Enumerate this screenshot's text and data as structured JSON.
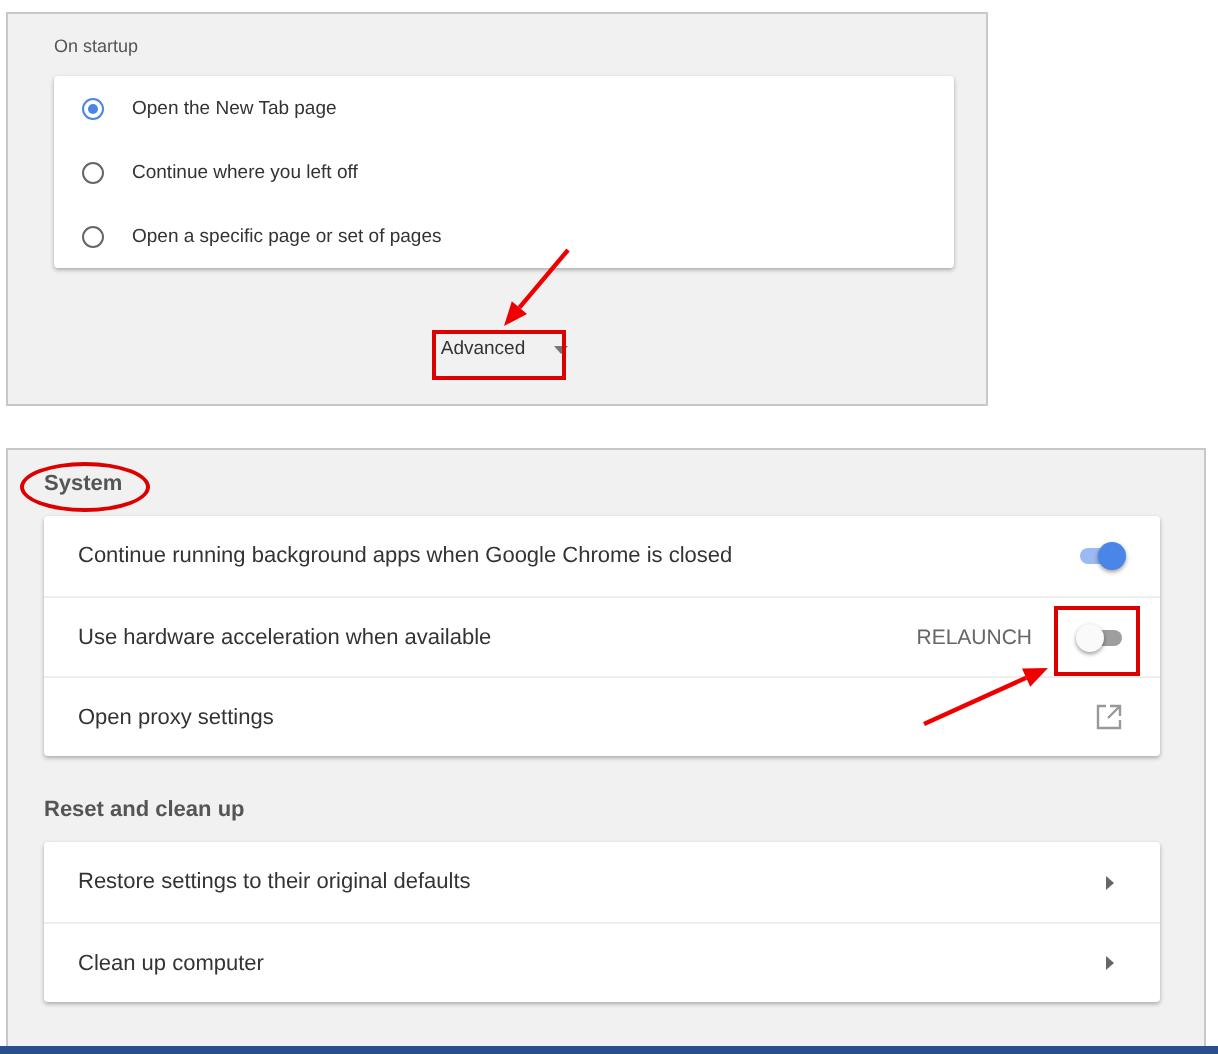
{
  "startup": {
    "heading": "On startup",
    "options": [
      {
        "label": "Open the New Tab page",
        "selected": true
      },
      {
        "label": "Continue where you left off",
        "selected": false
      },
      {
        "label": "Open a specific page or set of pages",
        "selected": false
      }
    ],
    "advanced_button": {
      "label": "Advanced"
    }
  },
  "system": {
    "heading": "System",
    "rows": [
      {
        "kind": "toggle",
        "label": "Continue running background apps when Google Chrome is closed",
        "on": true
      },
      {
        "kind": "toggle",
        "label": "Use hardware acceleration when available",
        "on": false,
        "action": "RELAUNCH"
      },
      {
        "kind": "external",
        "label": "Open proxy settings"
      }
    ]
  },
  "reset": {
    "heading": "Reset and clean up",
    "rows": [
      {
        "kind": "submenu",
        "label": "Restore settings to their original defaults"
      },
      {
        "kind": "submenu",
        "label": "Clean up computer"
      }
    ]
  }
}
